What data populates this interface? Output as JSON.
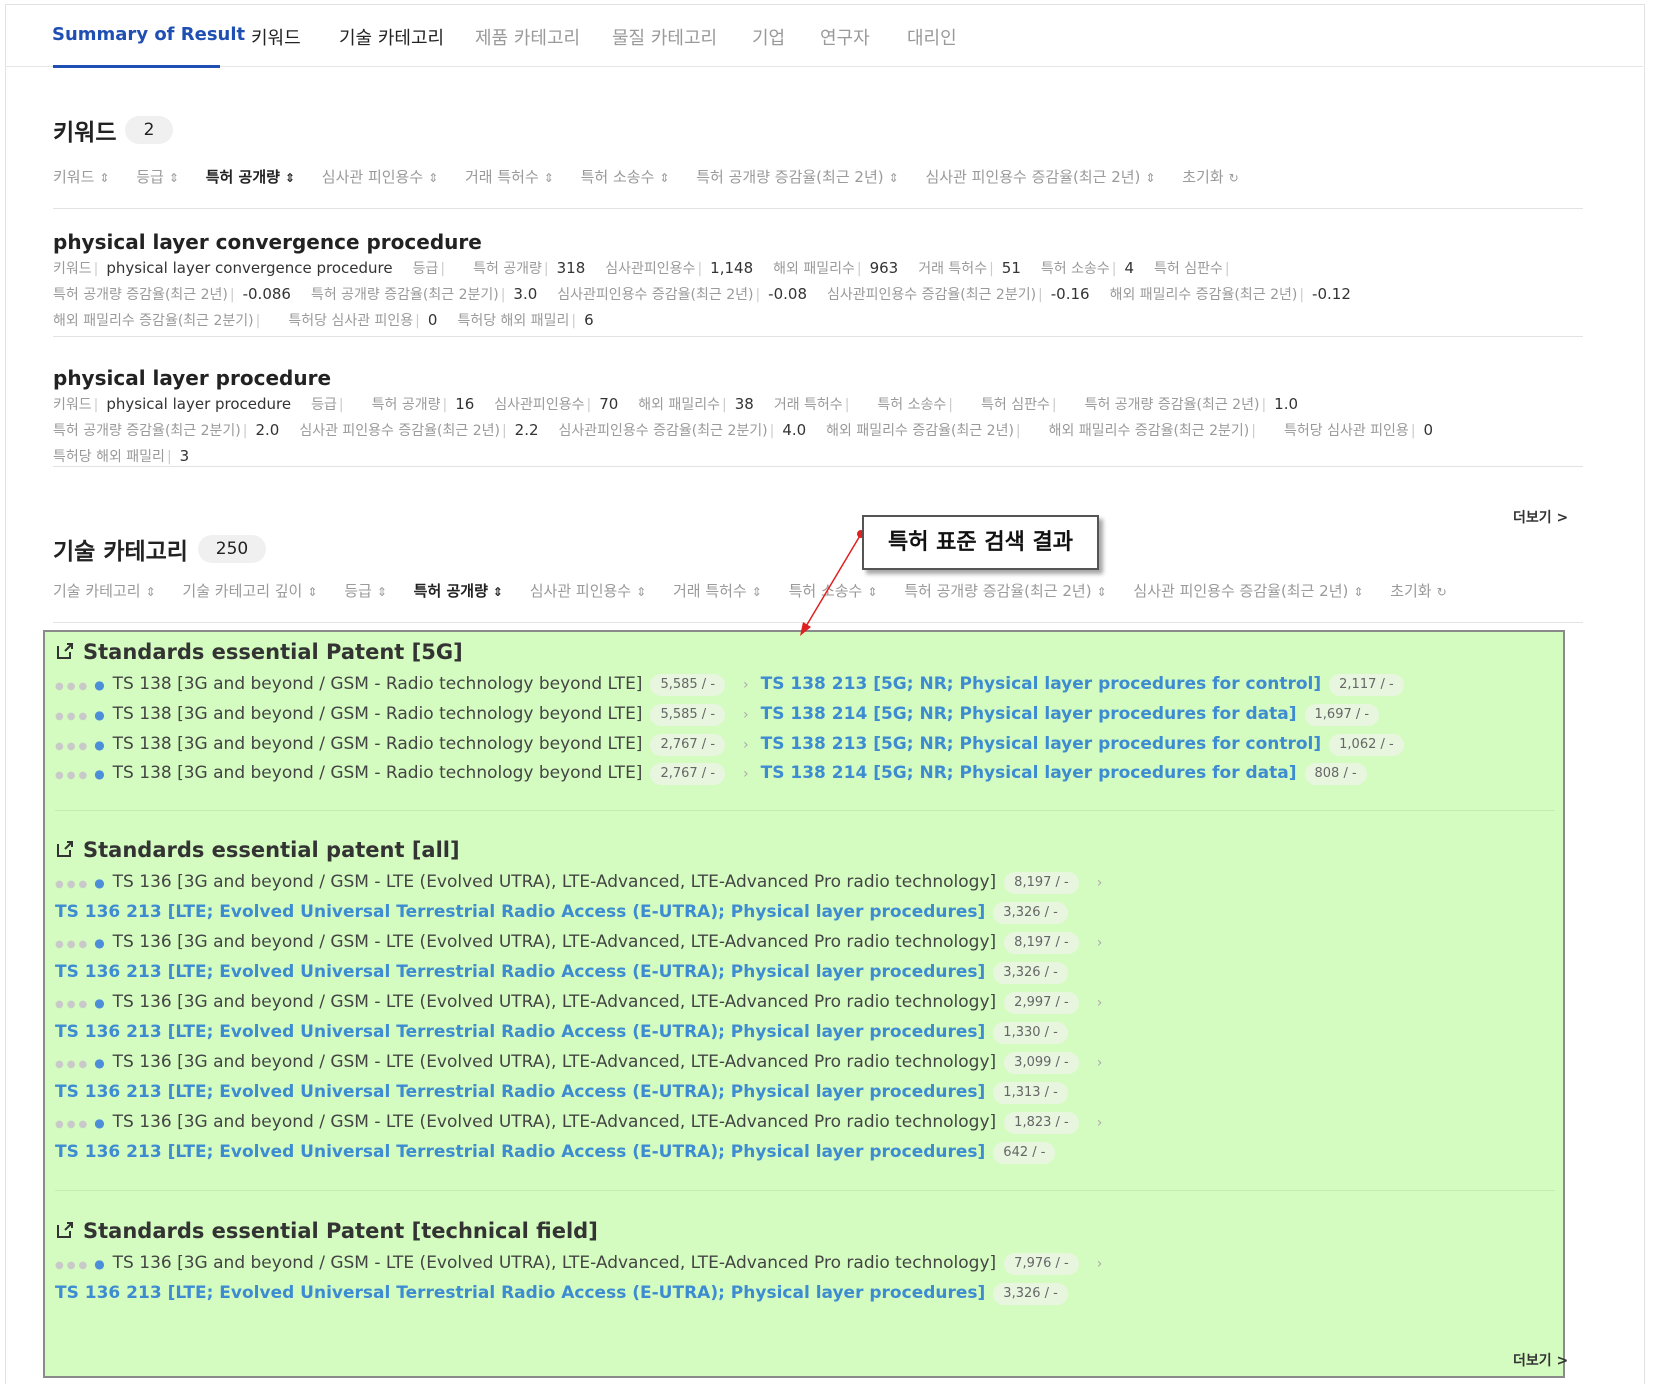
{
  "tabs": [
    "Summary of Result",
    "키워드",
    "기술 카테고리",
    "제품 카테고리",
    "물질 카테고리",
    "기업",
    "연구자",
    "대리인"
  ],
  "keyword_section": {
    "title": "키워드",
    "count": "2",
    "sort_options": [
      "키워드",
      "등급",
      "특허 공개량",
      "심사관 피인용수",
      "거래 특허수",
      "특허 소송수",
      "특허 공개량 증감율(최근 2년)",
      "심사관 피인용수 증감율(최근 2년)"
    ],
    "reset": "초기화",
    "items": [
      {
        "title": "physical layer convergence procedure",
        "rows": [
          [
            [
              "키워드",
              "physical layer convergence procedure"
            ],
            [
              "등급",
              ""
            ],
            [
              "특허 공개량",
              "318"
            ],
            [
              "심사관피인용수",
              "1,148"
            ],
            [
              "해외 패밀리수",
              "963"
            ],
            [
              "거래 특허수",
              "51"
            ],
            [
              "특허 소송수",
              "4"
            ],
            [
              "특허 심판수",
              ""
            ]
          ],
          [
            [
              "특허 공개량 증감율(최근 2년)",
              "-0.086"
            ],
            [
              "특허 공개량 증감율(최근 2분기)",
              "3.0"
            ],
            [
              "심사관피인용수 증감율(최근 2년)",
              "-0.08"
            ],
            [
              "심사관피인용수 증감율(최근 2분기)",
              "-0.16"
            ],
            [
              "해외 패밀리수 증감율(최근 2년)",
              "-0.12"
            ]
          ],
          [
            [
              "해외 패밀리수 증감율(최근 2분기)",
              ""
            ],
            [
              "특허당 심사관 피인용",
              "0"
            ],
            [
              "특허당 해외 패밀리",
              "6"
            ]
          ]
        ]
      },
      {
        "title": "physical layer procedure",
        "rows": [
          [
            [
              "키워드",
              "physical layer procedure"
            ],
            [
              "등급",
              ""
            ],
            [
              "특허 공개량",
              "16"
            ],
            [
              "심사관피인용수",
              "70"
            ],
            [
              "해외 패밀리수",
              "38"
            ],
            [
              "거래 특허수",
              ""
            ],
            [
              "특허 소송수",
              ""
            ],
            [
              "특허 심판수",
              ""
            ],
            [
              "특허 공개량 증감율(최근 2년)",
              "1.0"
            ]
          ],
          [
            [
              "특허 공개량 증감율(최근 2분기)",
              "2.0"
            ],
            [
              "심사관 피인용수 증감율(최근 2년)",
              "2.2"
            ],
            [
              "심사관피인용수 증감율(최근 2분기)",
              "4.0"
            ],
            [
              "해외 패밀리수 증감율(최근 2년)",
              ""
            ],
            [
              "해외 패밀리수 증감율(최근 2분기)",
              ""
            ],
            [
              "특허당 심사관 피인용",
              "0"
            ]
          ],
          [
            [
              "특허당 해외 패밀리",
              "3"
            ]
          ]
        ]
      }
    ],
    "more": "더보기 >"
  },
  "tech_section": {
    "title": "기술 카테고리",
    "count": "250",
    "sort_options": [
      "기술 카테고리",
      "기술 카테고리 깊이",
      "등급",
      "특허 공개량",
      "심사관 피인용수",
      "거래 특허수",
      "특허 소송수",
      "특허 공개량 증감율(최근 2년)",
      "심사관 피인용수 증감율(최근 2년)"
    ],
    "reset": "초기화",
    "callout": "특허 표준 검색 결과",
    "groups": [
      {
        "title": "Standards essential Patent [5G]",
        "lines": [
          {
            "parent": "TS 138 [3G and beyond / GSM - Radio technology beyond LTE]",
            "parent_count": "5,585 / -",
            "child": "TS 138 213 [5G; NR; Physical layer procedures for control]",
            "child_count": "2,117 / -"
          },
          {
            "parent": "TS 138 [3G and beyond / GSM - Radio technology beyond LTE]",
            "parent_count": "5,585 / -",
            "child": "TS 138 214 [5G; NR; Physical layer procedures for data]",
            "child_count": "1,697 / -"
          },
          {
            "parent": "TS 138 [3G and beyond / GSM - Radio technology beyond LTE]",
            "parent_count": "2,767 / -",
            "child": "TS 138 213 [5G; NR; Physical layer procedures for control]",
            "child_count": "1,062 / -"
          },
          {
            "parent": "TS 138 [3G and beyond / GSM - Radio technology beyond LTE]",
            "parent_count": "2,767 / -",
            "child": "TS 138 214 [5G; NR; Physical layer procedures for data]",
            "child_count": "808 / -"
          }
        ]
      },
      {
        "title": "Standards essential patent [all]",
        "lines": [
          {
            "parent": "TS 136 [3G and beyond / GSM - LTE (Evolved UTRA), LTE-Advanced, LTE-Advanced Pro radio technology]",
            "parent_count": "8,197 / -",
            "child": "TS 136 213 [LTE; Evolved Universal Terrestrial Radio Access (E-UTRA); Physical layer procedures]",
            "child_count": "3,326 / -"
          },
          {
            "parent": "TS 136 [3G and beyond / GSM - LTE (Evolved UTRA), LTE-Advanced, LTE-Advanced Pro radio technology]",
            "parent_count": "8,197 / -",
            "child": "TS 136 213 [LTE; Evolved Universal Terrestrial Radio Access (E-UTRA); Physical layer procedures]",
            "child_count": "3,326 / -"
          },
          {
            "parent": "TS 136 [3G and beyond / GSM - LTE (Evolved UTRA), LTE-Advanced, LTE-Advanced Pro radio technology]",
            "parent_count": "2,997 / -",
            "child": "TS 136 213 [LTE; Evolved Universal Terrestrial Radio Access (E-UTRA); Physical layer procedures]",
            "child_count": "1,330 / -"
          },
          {
            "parent": "TS 136 [3G and beyond / GSM - LTE (Evolved UTRA), LTE-Advanced, LTE-Advanced Pro radio technology]",
            "parent_count": "3,099 / -",
            "child": "TS 136 213 [LTE; Evolved Universal Terrestrial Radio Access (E-UTRA); Physical layer procedures]",
            "child_count": "1,313 / -"
          },
          {
            "parent": "TS 136 [3G and beyond / GSM - LTE (Evolved UTRA), LTE-Advanced, LTE-Advanced Pro radio technology]",
            "parent_count": "1,823 / -",
            "child": "TS 136 213 [LTE; Evolved Universal Terrestrial Radio Access (E-UTRA); Physical layer procedures]",
            "child_count": "642 / -"
          }
        ]
      },
      {
        "title": "Standards essential Patent [technical field]",
        "lines": [
          {
            "parent": "TS 136 [3G and beyond / GSM - LTE (Evolved UTRA), LTE-Advanced, LTE-Advanced Pro radio technology]",
            "parent_count": "7,976 / -",
            "child": "TS 136 213 [LTE; Evolved Universal Terrestrial Radio Access (E-UTRA); Physical layer procedures]",
            "child_count": "3,326 / -"
          }
        ]
      }
    ],
    "more": "더보기 >"
  },
  "colors": {
    "accent": "#1f4fb2",
    "link": "#3d8bd1",
    "highlight": "#d4fcc0",
    "arrow": "#e02020"
  }
}
